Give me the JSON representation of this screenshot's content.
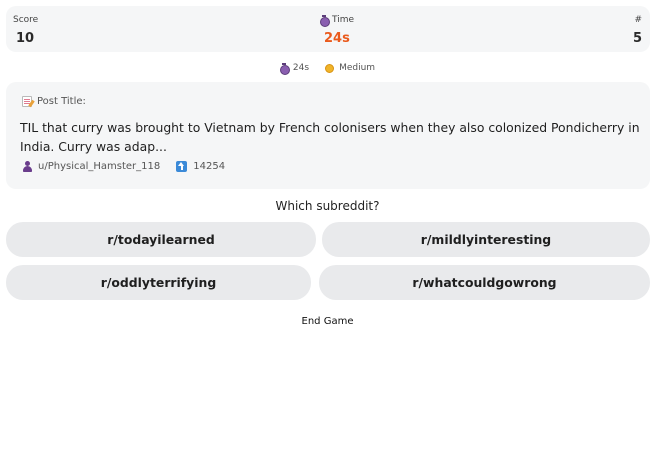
{
  "stats": {
    "score_label": "Score",
    "score_value": "10",
    "time_label": "Time",
    "time_value": "24s",
    "count_label": "#",
    "count_value": "5"
  },
  "meta": {
    "timer": "24s",
    "difficulty": "Medium"
  },
  "post": {
    "label": "Post Title:",
    "title": "TIL that curry was brought to Vietnam by French colonisers when they also colonized Pondicherry in India. Curry was adap...",
    "author": "u/Physical_Hamster_118",
    "upvotes": "14254"
  },
  "question": "Which subreddit?",
  "choices": [
    "r/todayilearned",
    "r/mildlyinteresting",
    "r/oddlyterrifying",
    "r/whatcouldgowrong"
  ],
  "end_game_label": "End Game",
  "colors": {
    "time_accent": "#ea5a1c",
    "card_background": "#f5f6f7",
    "choice_background": "#e9eaec"
  }
}
